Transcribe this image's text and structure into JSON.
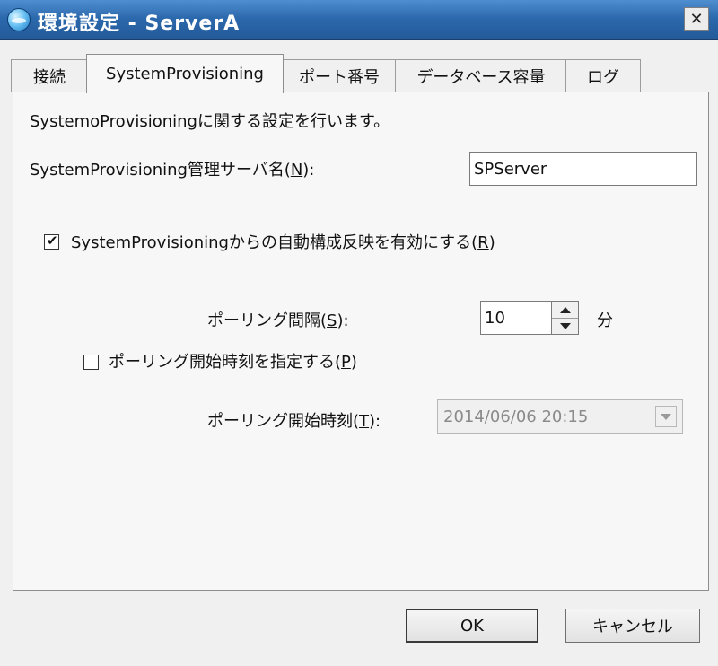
{
  "window": {
    "title": "環境設定 - ServerA",
    "close_glyph": "✕"
  },
  "tabs": [
    {
      "label": "接続"
    },
    {
      "label": "SystemProvisioning",
      "selected": true
    },
    {
      "label": "ポート番号"
    },
    {
      "label": "データベース容量"
    },
    {
      "label": "ログ"
    }
  ],
  "panel": {
    "description": "SystemoProvisioningに関する設定を行います。",
    "server_name": {
      "label": "SystemProvisioning管理サーバ名(",
      "mnemonic": "N",
      "label_end": "):",
      "value": "SPServer"
    },
    "auto_reflect": {
      "label": "SystemProvisioningからの自動構成反映を有効にする(",
      "mnemonic": "R",
      "label_end": ")",
      "checked": true
    },
    "polling_interval": {
      "label": "ポーリング間隔(",
      "mnemonic": "S",
      "label_end": "):",
      "value": "10",
      "unit": "分"
    },
    "specify_start": {
      "label": "ポーリング開始時刻を指定する(",
      "mnemonic": "P",
      "label_end": ")",
      "checked": false
    },
    "start_time": {
      "label": "ポーリング開始時刻(",
      "mnemonic": "T",
      "label_end": "):",
      "value": "2014/06/06 20:15",
      "enabled": false
    }
  },
  "buttons": {
    "ok": "OK",
    "cancel": "キャンセル"
  },
  "colors": {
    "titlebar": "#2c69ad",
    "window_bg": "#f0f0f0",
    "panel_bg": "#f7f7f7",
    "disabled_text": "#8a8a8a"
  },
  "icons": {
    "app": "app-globe-icon",
    "checkmark": "✔"
  }
}
